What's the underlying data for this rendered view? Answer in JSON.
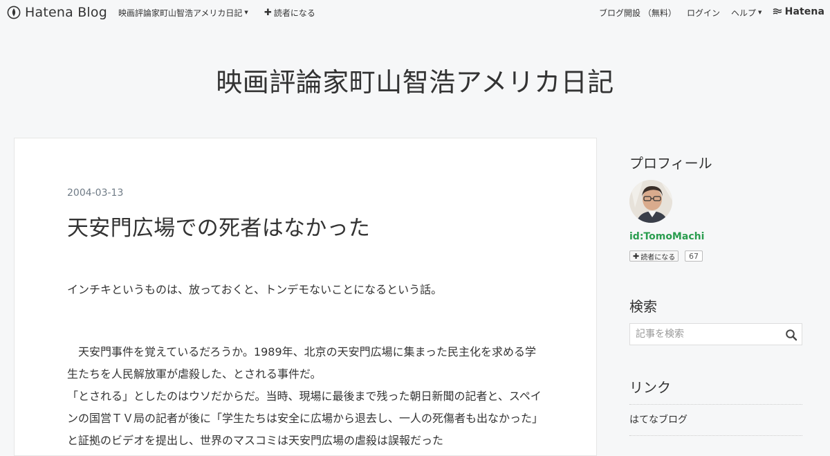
{
  "topbar": {
    "brand": "Hatena Blog",
    "blog_menu": "映画評論家町山智浩アメリカ日記",
    "subscribe": "読者になる",
    "open_blog": "ブログ開設 （無料）",
    "login": "ログイン",
    "help": "ヘルプ",
    "hatena": "Hatena"
  },
  "site": {
    "title": "映画評論家町山智浩アメリカ日記"
  },
  "entry": {
    "date": "2004-03-13",
    "title": "天安門広場での死者はなかった",
    "lead": "インチキというものは、放っておくと、トンデモないことになるという話。",
    "paragraphs": [
      "　天安門事件を覚えているだろうか。1989年、北京の天安門広場に集まった民主化を求める学生たちを人民解放軍が虐殺した、とされる事件だ。",
      "「とされる」としたのはウソだからだ。当時、現場に最後まで残った朝日新聞の記者と、スペインの国営ＴＶ局の記者が後に「学生たちは安全に広場から退去し、一人の死傷者も出なかった」と証拠のビデオを提出し、世界のマスコミは天安門広場の虐殺は誤報だった"
    ]
  },
  "sidebar": {
    "profile": {
      "heading": "プロフィール",
      "id": "id:TomoMachi",
      "subscribe_label": "読者になる",
      "subscriber_count": "67"
    },
    "search": {
      "heading": "検索",
      "placeholder": "記事を検索"
    },
    "links": {
      "heading": "リンク",
      "items": [
        "はてなブログ"
      ]
    }
  }
}
